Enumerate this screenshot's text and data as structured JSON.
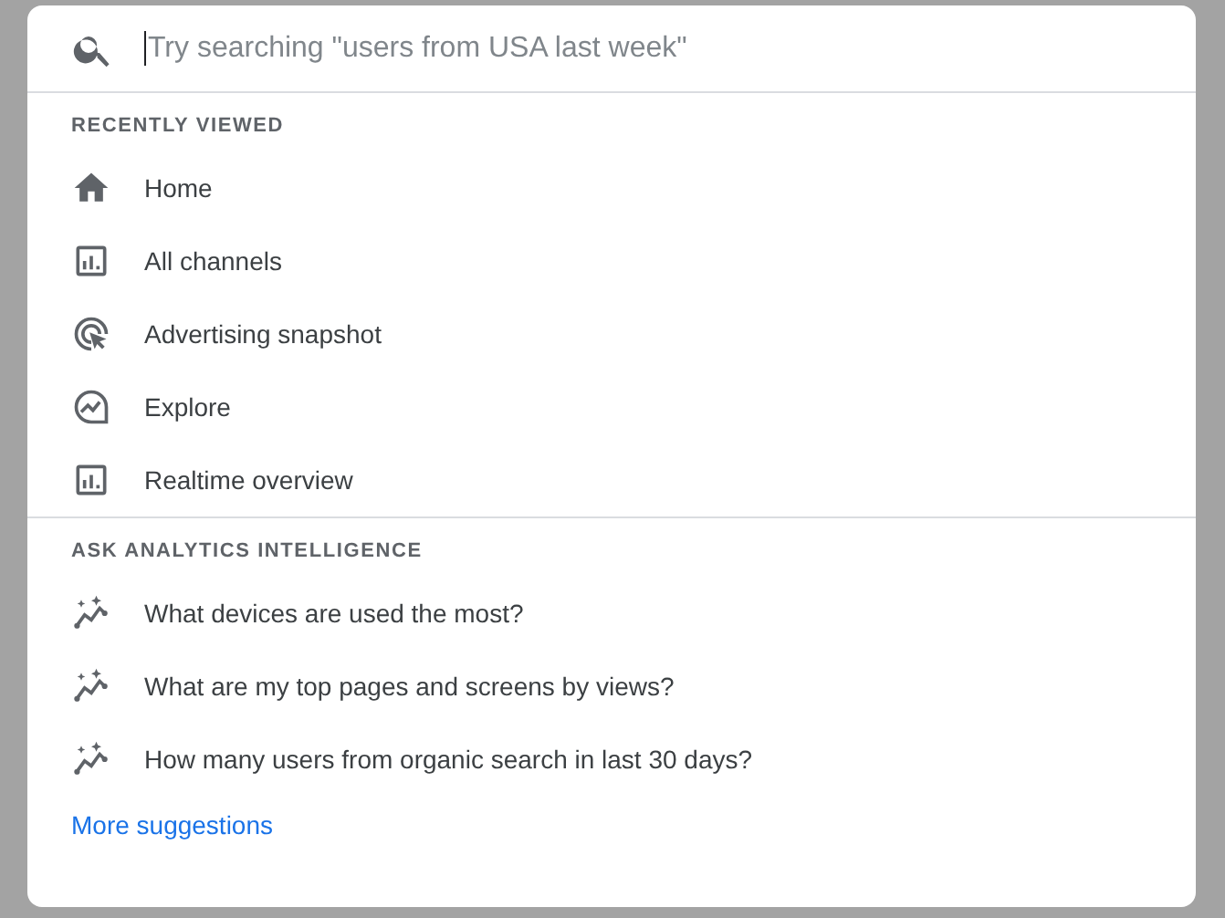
{
  "search": {
    "placeholder": "Try searching \"users from USA last week\""
  },
  "sections": [
    {
      "title": "RECENTLY VIEWED",
      "items": [
        {
          "kind": "home",
          "label": "Home"
        },
        {
          "kind": "report",
          "label": "All channels"
        },
        {
          "kind": "advertising",
          "label": "Advertising snapshot"
        },
        {
          "kind": "explore",
          "label": "Explore"
        },
        {
          "kind": "report",
          "label": "Realtime overview"
        }
      ]
    },
    {
      "title": "ASK ANALYTICS INTELLIGENCE",
      "items": [
        {
          "kind": "insight",
          "label": "What devices are used the most?"
        },
        {
          "kind": "insight",
          "label": "What are my top pages and screens by views?"
        },
        {
          "kind": "insight",
          "label": "How many users from organic search in last 30 days?"
        }
      ],
      "link": "More suggestions"
    }
  ]
}
